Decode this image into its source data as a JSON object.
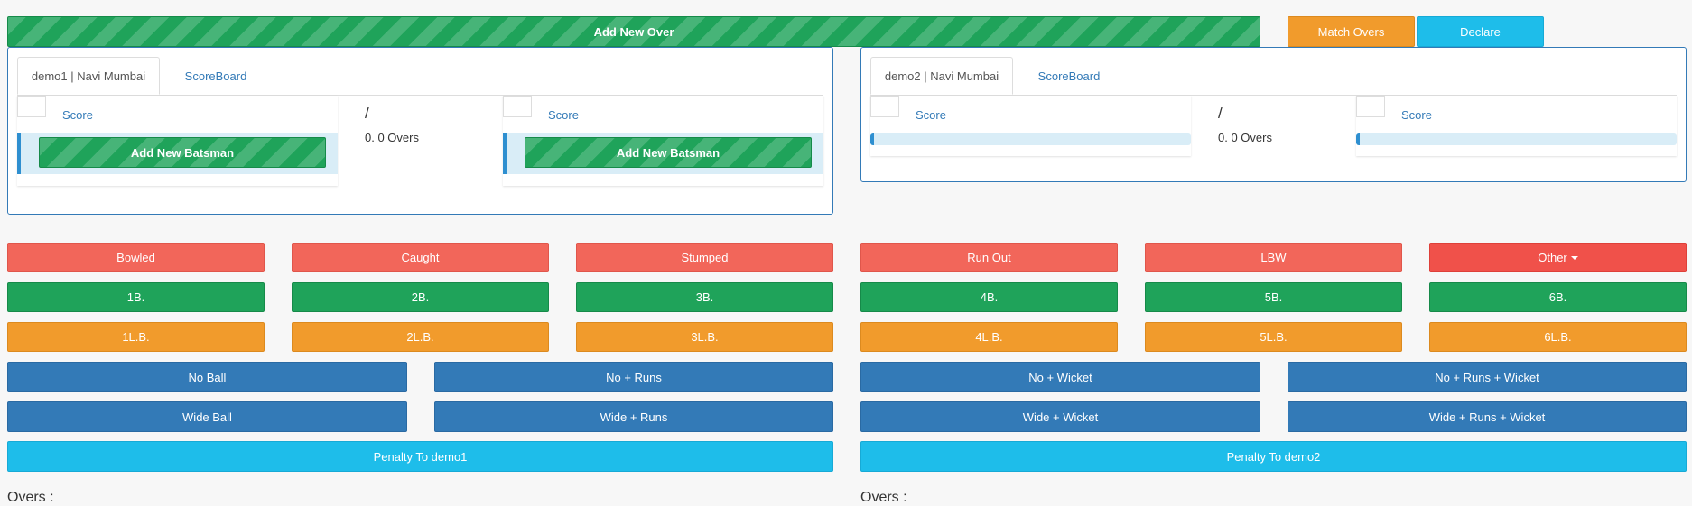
{
  "top": {
    "add_over": "Add New Over",
    "match_overs": "Match Overs",
    "declare": "Declare"
  },
  "teams": [
    {
      "tab": "demo1 | Navi Mumbai",
      "scoreboard": "ScoreBoard",
      "batsman1_label": "Score",
      "batsman2_label": "Score",
      "slash": "/",
      "overs": "0. 0 Overs",
      "add_batsman": "Add New Batsman"
    },
    {
      "tab": "demo2 | Navi Mumbai",
      "scoreboard": "ScoreBoard",
      "batsman1_label": "Score",
      "batsman2_label": "Score",
      "slash": "/",
      "overs": "0. 0 Overs"
    }
  ],
  "wickets": [
    "Bowled",
    "Caught",
    "Stumped",
    "Run Out",
    "LBW",
    "Other"
  ],
  "byes": [
    "1B.",
    "2B.",
    "3B.",
    "4B.",
    "5B.",
    "6B."
  ],
  "legbyes": [
    "1L.B.",
    "2L.B.",
    "3L.B.",
    "4L.B.",
    "5L.B.",
    "6L.B."
  ],
  "extras": {
    "no_ball": "No Ball",
    "no_runs": "No + Runs",
    "no_wicket": "No + Wicket",
    "no_runs_wicket": "No + Runs + Wicket",
    "wide_ball": "Wide Ball",
    "wide_runs": "Wide + Runs",
    "wide_wicket": "Wide + Wicket",
    "wide_runs_wicket": "Wide + Runs + Wicket"
  },
  "penalty": {
    "team1": "Penalty To demo1",
    "team2": "Penalty To demo2"
  },
  "footer": {
    "left": "Overs :",
    "right": "Overs :"
  },
  "colors": {
    "danger": "#f2665a",
    "success": "#1fa35a",
    "warning": "#f19b2c",
    "primary": "#337ab7",
    "info": "#1ebdea"
  },
  "progress": {
    "team2_batsman1": 0.01,
    "team2_batsman2": 0.01
  }
}
